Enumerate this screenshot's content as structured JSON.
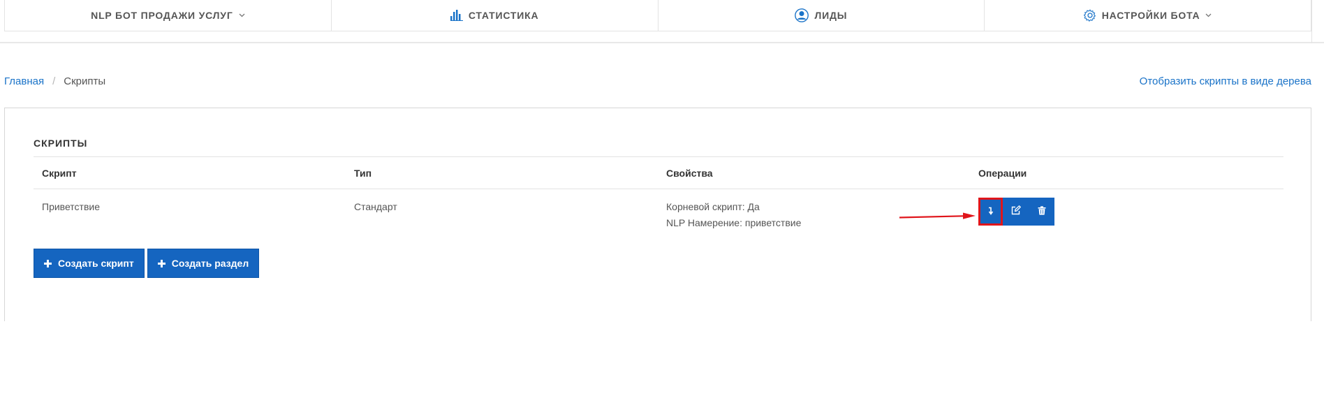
{
  "nav": {
    "items": [
      {
        "label": "NLP БОТ ПРОДАЖИ УСЛУГ",
        "icon": "chevron-down-icon"
      },
      {
        "label": "СТАТИСТИКА",
        "icon": "bar-chart-icon"
      },
      {
        "label": "ЛИДЫ",
        "icon": "user-icon"
      },
      {
        "label": "НАСТРОЙКИ БОТА",
        "icon": "gear-icon"
      }
    ]
  },
  "breadcrumb": {
    "home": "Главная",
    "separator": "/",
    "current": "Скрипты"
  },
  "tree_link": "Отобразить скрипты в виде дерева",
  "panel": {
    "title": "СКРИПТЫ",
    "columns": [
      "Скрипт",
      "Тип",
      "Свойства",
      "Операции"
    ],
    "rows": [
      {
        "script": "Приветствие",
        "type": "Стандарт",
        "props": [
          "Корневой скрипт: Да",
          "NLP Намерение: приветствие"
        ],
        "operations": [
          "move-down-icon",
          "edit-icon",
          "trash-icon"
        ]
      }
    ],
    "create_script": "Создать скрипт",
    "create_section": "Создать раздел"
  },
  "colors": {
    "accent": "#1565c0",
    "link": "#1a73c8",
    "highlight": "#e0151b"
  }
}
